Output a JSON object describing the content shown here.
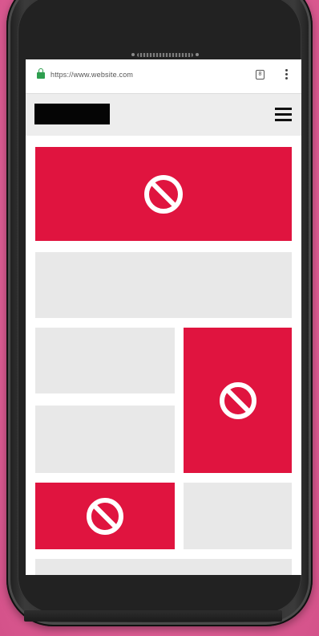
{
  "browser": {
    "url": "https://www.website.com",
    "tab_count": "8",
    "secure": true
  },
  "site": {
    "logo": "redacted-black-logo",
    "menu_icon": "hamburger-icon"
  },
  "layout_blocks": [
    {
      "kind": "ad",
      "icon": "blocked-icon"
    },
    {
      "kind": "content"
    },
    {
      "kind": "content"
    },
    {
      "kind": "ad",
      "icon": "blocked-icon"
    },
    {
      "kind": "content"
    },
    {
      "kind": "ad",
      "icon": "blocked-icon"
    },
    {
      "kind": "content"
    },
    {
      "kind": "content"
    }
  ],
  "colors": {
    "background": "#e0689a",
    "ad_block": "#e0143f",
    "content_block": "#e8e8e8",
    "lock": "#2e9e4f",
    "phone_body": "#262626"
  }
}
